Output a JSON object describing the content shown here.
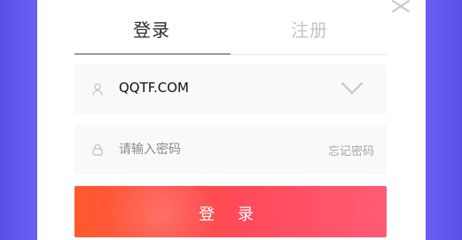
{
  "tabs": {
    "login_label": "登录",
    "register_label": "注册"
  },
  "username": {
    "value": "QQTF.COM"
  },
  "password": {
    "placeholder": "请输入密码",
    "forgot_label": "忘记密码"
  },
  "actions": {
    "login_label": "登 录"
  },
  "icons": {
    "close": "close-icon",
    "user": "user-icon",
    "lock": "lock-icon",
    "dropdown": "chevron-down-icon"
  },
  "colors": {
    "background": "#5a4fe6",
    "primary_gradient_start": "#ff5a2e",
    "primary_gradient_end": "#ff5b76",
    "active_tab_text": "#2b2b2b",
    "inactive_tab_text": "#c4c4c4"
  }
}
